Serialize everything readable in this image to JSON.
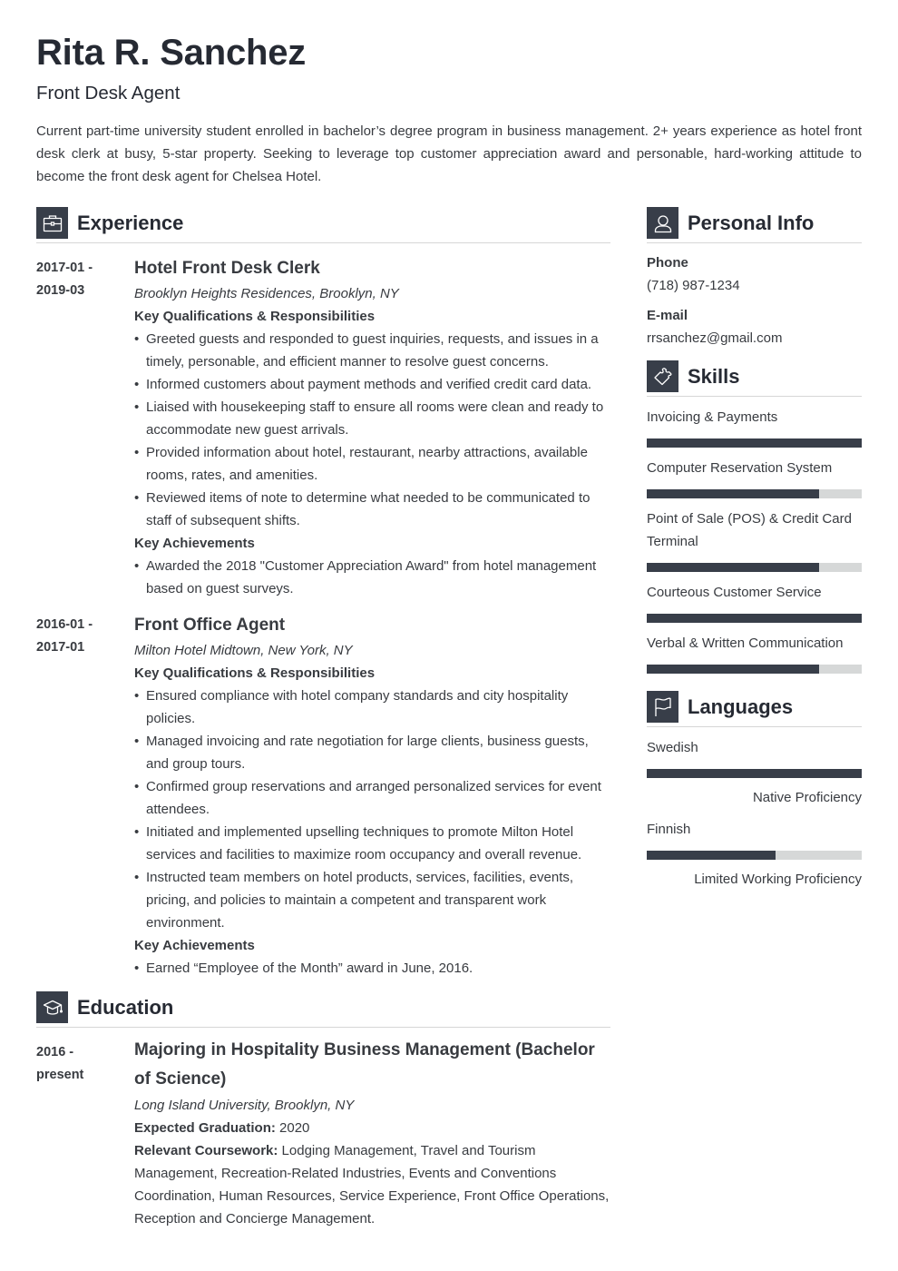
{
  "header": {
    "name": "Rita R. Sanchez",
    "title": "Front Desk Agent",
    "summary": "Current part-time university student enrolled in bachelor’s degree program in business management. 2+ years experience as hotel front desk clerk at busy, 5-star property. Seeking to leverage top customer appreciation award and personable, hard-working attitude to become the front desk agent for Chelsea Hotel."
  },
  "colors": {
    "accent": "#383e49",
    "bar_track": "#d6d8d8",
    "text": "#383b40"
  },
  "experience": {
    "title": "Experience",
    "icon": "briefcase-icon",
    "jobs": [
      {
        "date_start": "2017-01 -",
        "date_end": "2019-03",
        "title": "Hotel Front Desk Clerk",
        "company": "Brooklyn Heights Residences, Brooklyn, NY",
        "resp_heading": "Key Qualifications & Responsibilities",
        "responsibilities": [
          "Greeted guests and responded to guest inquiries, requests, and issues in a timely, personable, and efficient manner to resolve guest concerns.",
          "Informed customers about payment methods and verified credit card data.",
          "Liaised with housekeeping staff to ensure all rooms were clean and ready to accommodate new guest arrivals.",
          "Provided information about hotel, restaurant, nearby attractions, available rooms, rates, and amenities.",
          "Reviewed items of note to determine what needed to be communicated to staff of subsequent shifts."
        ],
        "ach_heading": "Key Achievements",
        "achievements": [
          "Awarded the 2018 \"Customer Appreciation Award\" from hotel management based on guest surveys."
        ]
      },
      {
        "date_start": "2016-01 -",
        "date_end": "2017-01",
        "title": "Front Office Agent",
        "company": "Milton Hotel Midtown, New York, NY",
        "resp_heading": "Key Qualifications & Responsibilities",
        "responsibilities": [
          "Ensured compliance with hotel company standards and city hospitality policies.",
          "Managed invoicing and rate negotiation for large clients, business guests, and group tours.",
          "Confirmed group reservations and arranged personalized services for event attendees.",
          "Initiated and implemented upselling techniques to promote Milton Hotel services and facilities to maximize room occupancy and overall revenue.",
          "Instructed team members on hotel products, services, facilities, events, pricing, and policies to maintain a competent and transparent work environment."
        ],
        "ach_heading": "Key Achievements",
        "achievements": [
          "Earned “Employee of the Month” award in June, 2016."
        ]
      }
    ]
  },
  "education": {
    "title": "Education",
    "icon": "graduation-cap-icon",
    "entries": [
      {
        "date_start": "2016 -",
        "date_end": "present",
        "degree": "Majoring in Hospitality Business Management (Bachelor of Science)",
        "school": "Long Island University, Brooklyn, NY",
        "grad_label": "Expected Graduation:",
        "grad_value": " 2020",
        "course_label": "Relevant Coursework:",
        "course_value": " Lodging Management, Travel and Tourism Management, Recreation-Related Industries, Events and Conventions Coordination, Human Resources, Service Experience, Front Office Operations, Reception and Concierge Management."
      }
    ]
  },
  "personal_info": {
    "title": "Personal Info",
    "icon": "user-icon",
    "phone_label": "Phone",
    "phone": "(718) 987-1234",
    "email_label": "E-mail",
    "email": "rrsanchez@gmail.com"
  },
  "skills": {
    "title": "Skills",
    "icon": "puzzle-icon",
    "items": [
      {
        "name": "Invoicing & Payments",
        "level": 1.0
      },
      {
        "name": "Computer Reservation System",
        "level": 0.8
      },
      {
        "name": "Point of Sale (POS) & Credit Card Terminal",
        "level": 0.8
      },
      {
        "name": "Courteous Customer Service",
        "level": 1.0
      },
      {
        "name": "Verbal & Written Communication",
        "level": 0.8
      }
    ]
  },
  "languages": {
    "title": "Languages",
    "icon": "flag-icon",
    "items": [
      {
        "name": "Swedish",
        "level": 1.0,
        "proficiency": "Native Proficiency"
      },
      {
        "name": "Finnish",
        "level": 0.6,
        "proficiency": "Limited Working Proficiency"
      }
    ]
  }
}
